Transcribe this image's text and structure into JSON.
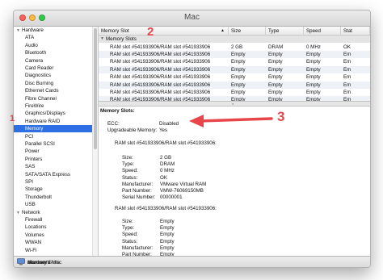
{
  "window": {
    "title": "Mac"
  },
  "sidebar": {
    "items": [
      {
        "label": "Hardware",
        "type": "cat"
      },
      {
        "label": "ATA",
        "type": "item"
      },
      {
        "label": "Audio",
        "type": "item"
      },
      {
        "label": "Bluetooth",
        "type": "item"
      },
      {
        "label": "Camera",
        "type": "item"
      },
      {
        "label": "Card Reader",
        "type": "item"
      },
      {
        "label": "Diagnostics",
        "type": "item"
      },
      {
        "label": "Disc Burning",
        "type": "item"
      },
      {
        "label": "Ethernet Cards",
        "type": "item"
      },
      {
        "label": "Fibre Channel",
        "type": "item"
      },
      {
        "label": "FireWire",
        "type": "item"
      },
      {
        "label": "Graphics/Displays",
        "type": "item"
      },
      {
        "label": "Hardware RAID",
        "type": "item"
      },
      {
        "label": "Memory",
        "type": "item",
        "selected": true
      },
      {
        "label": "PCI",
        "type": "item"
      },
      {
        "label": "Parallel SCSI",
        "type": "item"
      },
      {
        "label": "Power",
        "type": "item"
      },
      {
        "label": "Printers",
        "type": "item"
      },
      {
        "label": "SAS",
        "type": "item"
      },
      {
        "label": "SATA/SATA Express",
        "type": "item"
      },
      {
        "label": "SPI",
        "type": "item"
      },
      {
        "label": "Storage",
        "type": "item"
      },
      {
        "label": "Thunderbolt",
        "type": "item"
      },
      {
        "label": "USB",
        "type": "item"
      },
      {
        "label": "Network",
        "type": "cat"
      },
      {
        "label": "Firewall",
        "type": "item"
      },
      {
        "label": "Locations",
        "type": "item"
      },
      {
        "label": "Volumes",
        "type": "item"
      },
      {
        "label": "WWAN",
        "type": "item"
      },
      {
        "label": "Wi-Fi",
        "type": "item"
      }
    ]
  },
  "table": {
    "columns": [
      "Memory Slot",
      "Size",
      "Type",
      "Speed",
      "Stat"
    ],
    "group_label": "Memory Slots",
    "rows": [
      [
        "RAM slot #541933906/RAM slot #541933906",
        "2 GB",
        "DRAM",
        "0 MHz",
        "OK"
      ],
      [
        "RAM slot #541933906/RAM slot #541933906",
        "Empty",
        "Empty",
        "Empty",
        "Em"
      ],
      [
        "RAM slot #541933906/RAM slot #541933906",
        "Empty",
        "Empty",
        "Empty",
        "Em"
      ],
      [
        "RAM slot #541933906/RAM slot #541933906",
        "Empty",
        "Empty",
        "Empty",
        "Em"
      ],
      [
        "RAM slot #541933906/RAM slot #541933906",
        "Empty",
        "Empty",
        "Empty",
        "Em"
      ],
      [
        "RAM slot #541933906/RAM slot #541933906",
        "Empty",
        "Empty",
        "Empty",
        "Em"
      ],
      [
        "RAM slot #541933906/RAM slot #541933906",
        "Empty",
        "Empty",
        "Empty",
        "Em"
      ],
      [
        "RAM slot #541933906/RAM slot #541933906",
        "Empty",
        "Empty",
        "Empty",
        "Em"
      ]
    ]
  },
  "detail": {
    "heading": "Memory Slots:",
    "ecc_label": "ECC:",
    "ecc_value": "Disabled",
    "upgradeable_label": "Upgradeable Memory:",
    "upgradeable_value": "Yes",
    "slot1_title": "RAM slot #541933906/RAM slot #541933906:",
    "slot1_fields": [
      {
        "k": "Size:",
        "v": "2 GB"
      },
      {
        "k": "Type:",
        "v": "DRAM"
      },
      {
        "k": "Speed:",
        "v": "0 MHz"
      },
      {
        "k": "Status:",
        "v": "OK"
      },
      {
        "k": "Manufacturer:",
        "v": "VMware Virtual RAM"
      },
      {
        "k": "Part Number:",
        "v": "VMW-76069150MB"
      },
      {
        "k": "Serial Number:",
        "v": "00000001"
      }
    ],
    "slot2_title": "RAM slot #541933906/RAM slot #541933906:",
    "slot2_fields": [
      {
        "k": "Size:",
        "v": "Empty"
      },
      {
        "k": "Type:",
        "v": "Empty"
      },
      {
        "k": "Speed:",
        "v": "Empty"
      },
      {
        "k": "Status:",
        "v": "Empty"
      },
      {
        "k": "Manufacturer:",
        "v": "Empty"
      },
      {
        "k": "Part Number:",
        "v": "Empty"
      },
      {
        "k": "Serial Number:",
        "v": "Empty"
      }
    ]
  },
  "statusbar": {
    "path": [
      "devuser's Mac",
      "Hardware",
      "Memory",
      "Memory Slots"
    ],
    "separator": "▸"
  },
  "annotations": {
    "one": "1",
    "two": "2",
    "three": "3"
  },
  "colors": {
    "selection": "#2f6fe4",
    "annotation": "#e8464a"
  },
  "icons": {
    "computer": "computer-icon"
  }
}
